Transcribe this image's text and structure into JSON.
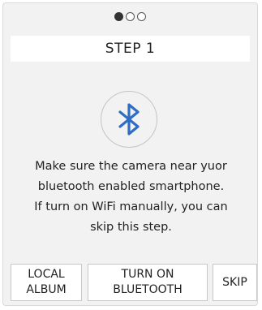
{
  "pager": {
    "total": 3,
    "active": 1
  },
  "step": {
    "title": "STEP 1"
  },
  "icon": {
    "name": "bluetooth-icon",
    "color": "#2f6cc4"
  },
  "message": {
    "lines": [
      "Make sure the camera near yuor",
      "bluetooth enabled smartphone.",
      "If turn on WiFi manually, you can",
      "skip this step."
    ]
  },
  "buttons": {
    "local_album": {
      "line1": "LOCAL",
      "line2": "ALBUM"
    },
    "turn_on_bluetooth": {
      "line1": "TURN ON",
      "line2": "BLUETOOTH"
    },
    "skip": {
      "label": "SKIP"
    }
  }
}
